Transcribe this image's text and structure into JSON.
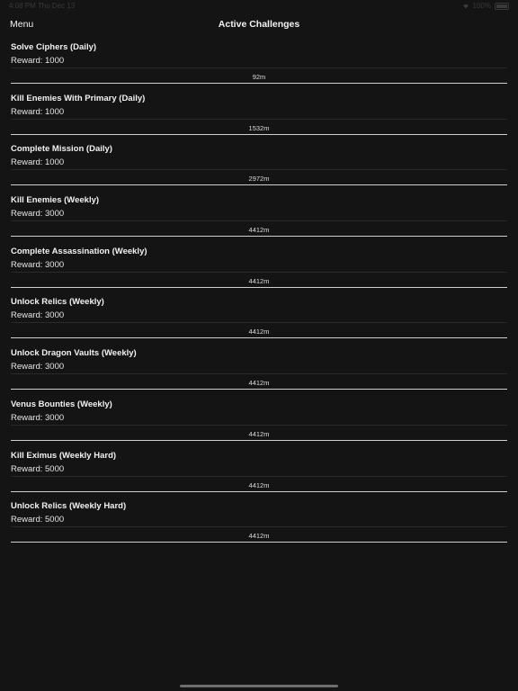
{
  "status_bar": {
    "time": "4:08 PM   Thu Dec 13",
    "battery": "100%"
  },
  "nav": {
    "menu_label": "Menu",
    "title": "Active Challenges"
  },
  "reward_prefix": "Reward:",
  "challenges": [
    {
      "title": "Solve Ciphers (Daily)",
      "reward": "1000",
      "time_left": "92m"
    },
    {
      "title": "Kill Enemies With Primary (Daily)",
      "reward": "1000",
      "time_left": "1532m"
    },
    {
      "title": "Complete Mission (Daily)",
      "reward": "1000",
      "time_left": "2972m"
    },
    {
      "title": "Kill Enemies (Weekly)",
      "reward": "3000",
      "time_left": "4412m"
    },
    {
      "title": "Complete Assassination (Weekly)",
      "reward": "3000",
      "time_left": "4412m"
    },
    {
      "title": "Unlock Relics (Weekly)",
      "reward": "3000",
      "time_left": "4412m"
    },
    {
      "title": "Unlock Dragon Vaults (Weekly)",
      "reward": "3000",
      "time_left": "4412m"
    },
    {
      "title": "Venus Bounties (Weekly)",
      "reward": "3000",
      "time_left": "4412m"
    },
    {
      "title": "Kill Eximus (Weekly Hard)",
      "reward": "5000",
      "time_left": "4412m"
    },
    {
      "title": "Unlock Relics (Weekly Hard)",
      "reward": "5000",
      "time_left": "4412m"
    }
  ]
}
